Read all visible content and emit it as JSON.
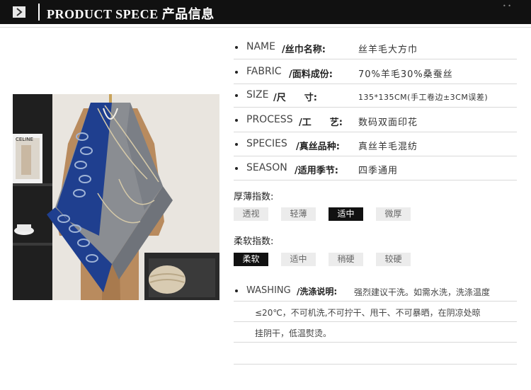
{
  "header": {
    "title": "PRODUCT SPECE 产品信息",
    "icon": "chevron-right-icon",
    "bg_color": "#111111"
  },
  "specs": [
    {
      "en": "NAME",
      "cn": "/丝巾名称:",
      "value": "丝羊毛大方巾"
    },
    {
      "en": "FABRIC",
      "cn": "/面料成份:",
      "value": "70%羊毛30%桑蚕丝"
    },
    {
      "en": "SIZE",
      "cn": "/尺　　寸:",
      "value": "135*135CM(手工卷边±3CM误差)"
    },
    {
      "en": "PROCESS",
      "cn": "/工　　艺:",
      "value": "数码双面印花"
    },
    {
      "en": "SPECIES",
      "cn": "/真丝品种:",
      "value": "真丝羊毛混纺"
    },
    {
      "en": "SEASON",
      "cn": "/适用季节:",
      "value": "四季通用"
    }
  ],
  "thickness": {
    "label": "厚薄指数:",
    "options": [
      "透视",
      "轻薄",
      "适中",
      "微厚"
    ],
    "selected": "适中"
  },
  "softness": {
    "label": "柔软指数:",
    "options": [
      "柔软",
      "适中",
      "稍硬",
      "较硬"
    ],
    "selected": "柔软"
  },
  "washing": {
    "en": "WASHING",
    "cn": "/洗涤说明:",
    "lines": [
      "强烈建议干洗。如需水洗，洗涤温度",
      "≤20℃，不可机洗,不可拧干、甩干、不可暴晒，在阴凉处晾",
      "挂阴干，低温熨烫。"
    ]
  },
  "photo": {
    "book_text": "CELINE"
  },
  "colors": {
    "scarf_blue": "#1f3f8f",
    "scarf_grey": "#8a8d92",
    "coat_camel": "#b98b5e",
    "active_option": "#111111"
  }
}
